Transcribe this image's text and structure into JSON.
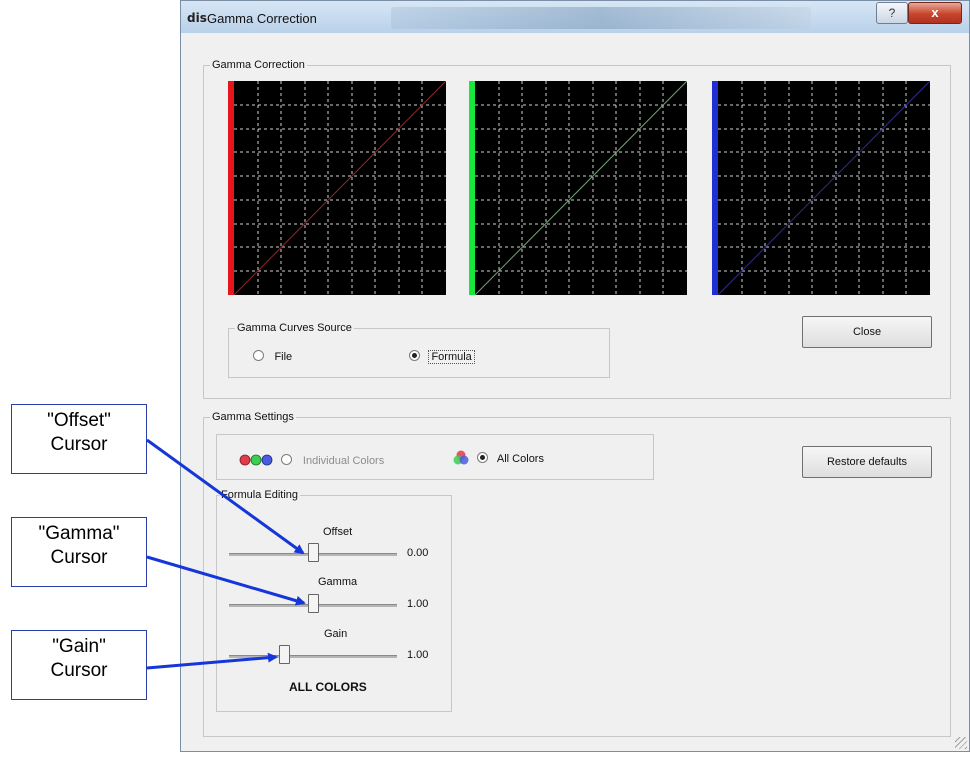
{
  "window": {
    "title": "Gamma Correction",
    "app_icon_text": "dis",
    "help_label": "?",
    "close_label": "x"
  },
  "gamma_correction": {
    "legend": "Gamma Correction",
    "plots": [
      {
        "channel": "red",
        "bar_color": "#e8141b",
        "line_color": "#8b2a2a"
      },
      {
        "channel": "green",
        "bar_color": "#18e83a",
        "line_color": "#6fa86f"
      },
      {
        "channel": "blue",
        "bar_color": "#1f2fd4",
        "line_color": "#2a2f8b"
      }
    ],
    "curves_source": {
      "legend": "Gamma Curves Source",
      "file_label": "File",
      "formula_label": "Formula",
      "selected": "Formula"
    },
    "close_button": "Close"
  },
  "gamma_settings": {
    "legend": "Gamma Settings",
    "individual_label": "Individual Colors",
    "all_label": "All Colors",
    "selected": "All Colors",
    "restore_button": "Restore defaults",
    "formula_editing": {
      "legend": "Formula Editing",
      "sliders": [
        {
          "label": "Offset",
          "value": "0.00",
          "position": 0.5
        },
        {
          "label": "Gamma",
          "value": "1.00",
          "position": 0.5
        },
        {
          "label": "Gain",
          "value": "1.00",
          "position": 0.33
        }
      ],
      "mode_label": "ALL COLORS"
    }
  },
  "callouts": {
    "offset": [
      "\"Offset\"",
      "Cursor"
    ],
    "gamma": [
      "\"Gamma\"",
      "Cursor"
    ],
    "gain": [
      "\"Gain\"",
      "Cursor"
    ]
  },
  "colors": {
    "callout_border": "#2b3ea8",
    "arrow": "#1536d8",
    "window_bg": "#f0f0f0"
  }
}
